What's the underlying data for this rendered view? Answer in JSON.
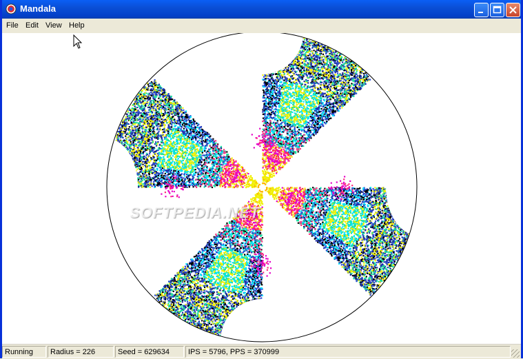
{
  "window": {
    "title": "Mandala",
    "colors": {
      "titlebar": "#0A4FD6",
      "close": "#C7442B"
    }
  },
  "menu": {
    "items": [
      {
        "label": "File"
      },
      {
        "label": "Edit"
      },
      {
        "label": "View"
      },
      {
        "label": "Help"
      }
    ]
  },
  "canvas": {
    "watermark": "SOFTPEDIA.NET",
    "palette": [
      "#1E2DA8",
      "#2A4BD0",
      "#00E5FF",
      "#17E0A0",
      "#F0F000",
      "#FF2F7E",
      "#E600C8",
      "#FFB000",
      "#FF3030",
      "#000000"
    ]
  },
  "status": {
    "state": "Running",
    "radius": "Radius = 226",
    "seed": "Seed = 629634",
    "rates": "IPS = 5796, PPS = 370999"
  }
}
